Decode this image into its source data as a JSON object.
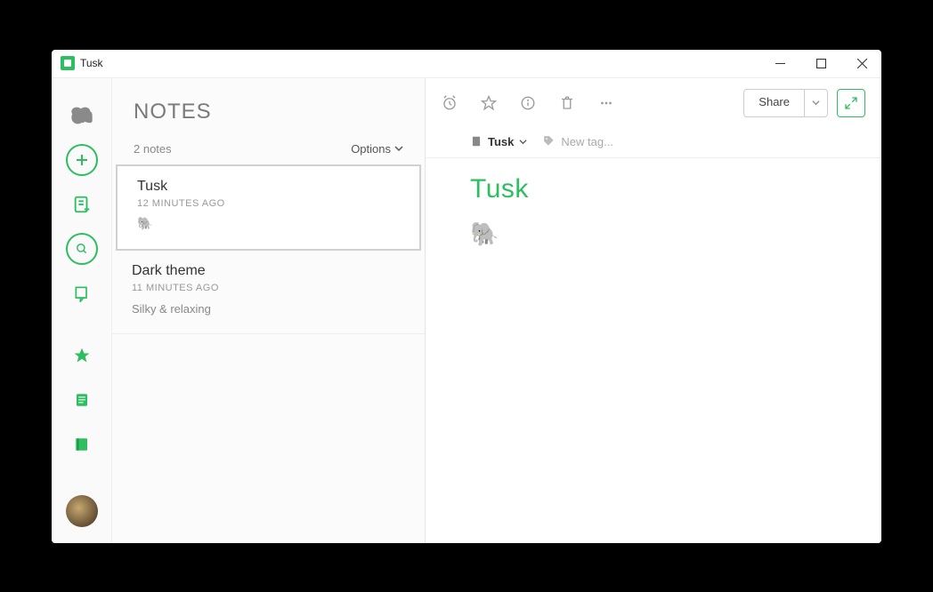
{
  "titlebar": {
    "app_name": "Tusk"
  },
  "notes_panel": {
    "heading": "NOTES",
    "count_text": "2 notes",
    "options_label": "Options",
    "items": [
      {
        "title": "Tusk",
        "time": "12 MINUTES AGO",
        "preview_icon": "🐘"
      },
      {
        "title": "Dark theme",
        "time": "11 MINUTES AGO",
        "preview": "Silky & relaxing"
      }
    ]
  },
  "editor": {
    "share_label": "Share",
    "notebook_name": "Tusk",
    "new_tag_placeholder": "New tag...",
    "note_title": "Tusk",
    "body_icon": "🐘"
  }
}
